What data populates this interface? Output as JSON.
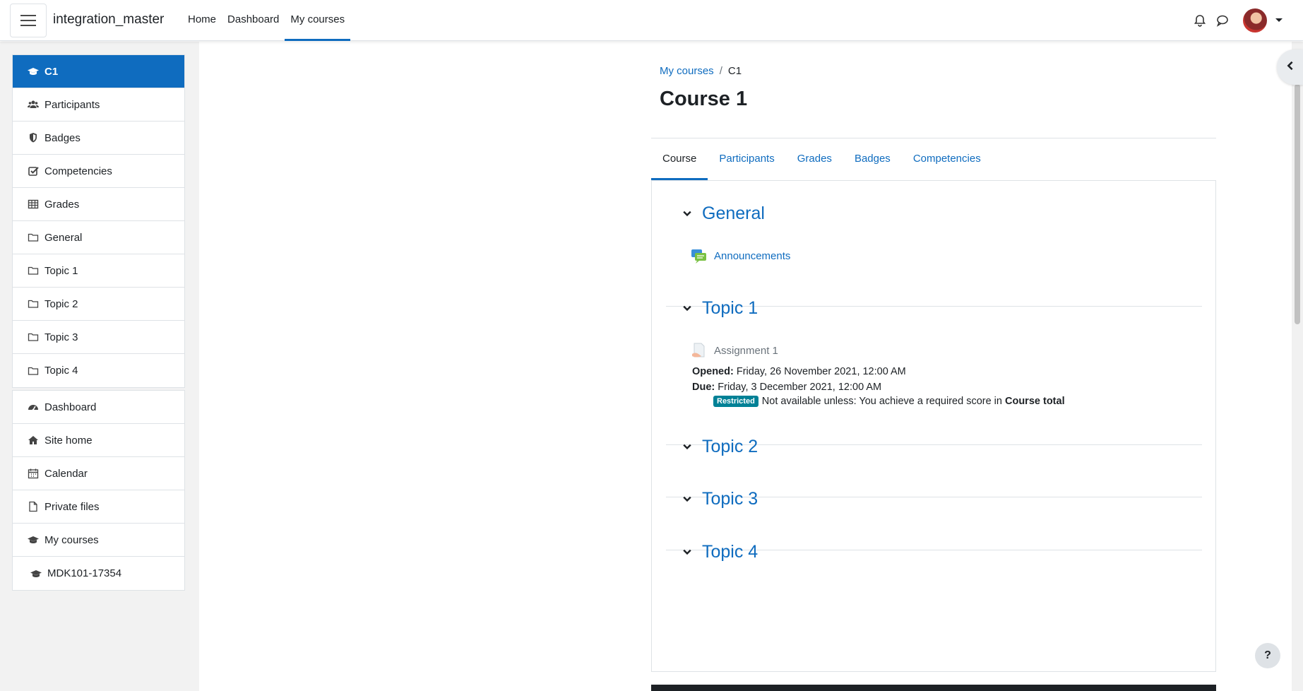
{
  "site": {
    "name": "integration_master"
  },
  "topnav": [
    {
      "label": "Home"
    },
    {
      "label": "Dashboard"
    },
    {
      "label": "My courses",
      "active": true
    }
  ],
  "drawer": {
    "course_items": [
      {
        "label": "C1",
        "icon": "graduation-cap-icon",
        "active": true
      },
      {
        "label": "Participants",
        "icon": "users-icon"
      },
      {
        "label": "Badges",
        "icon": "shield-icon"
      },
      {
        "label": "Competencies",
        "icon": "check-square-icon"
      },
      {
        "label": "Grades",
        "icon": "table-icon"
      },
      {
        "label": "General",
        "icon": "folder-icon"
      },
      {
        "label": "Topic 1",
        "icon": "folder-icon"
      },
      {
        "label": "Topic 2",
        "icon": "folder-icon"
      },
      {
        "label": "Topic 3",
        "icon": "folder-icon"
      },
      {
        "label": "Topic 4",
        "icon": "folder-icon"
      }
    ],
    "site_items": [
      {
        "label": "Dashboard",
        "icon": "tachometer-icon"
      },
      {
        "label": "Site home",
        "icon": "home-icon"
      },
      {
        "label": "Calendar",
        "icon": "calendar-icon"
      },
      {
        "label": "Private files",
        "icon": "file-icon"
      },
      {
        "label": "My courses",
        "icon": "graduation-cap-icon"
      },
      {
        "label": "MDK101-17354",
        "icon": "graduation-cap-icon"
      }
    ]
  },
  "breadcrumb": {
    "parent": "My courses",
    "separator": "/",
    "current": "C1"
  },
  "page": {
    "title": "Course 1"
  },
  "tabs": [
    {
      "label": "Course",
      "active": true
    },
    {
      "label": "Participants"
    },
    {
      "label": "Grades"
    },
    {
      "label": "Badges"
    },
    {
      "label": "Competencies"
    }
  ],
  "sections": {
    "general": {
      "title": "General",
      "activity": {
        "label": "Announcements",
        "icon": "forum-icon"
      }
    },
    "topic1": {
      "title": "Topic 1",
      "activity": {
        "label": "Assignment 1",
        "icon": "assignment-icon"
      },
      "opened_label": "Opened:",
      "opened_value": "Friday, 26 November 2021, 12:00 AM",
      "due_label": "Due:",
      "due_value": "Friday, 3 December 2021, 12:00 AM",
      "restriction_badge": "Restricted",
      "restriction_text": "Not available unless: You achieve a required score in",
      "restriction_bold": "Course total"
    },
    "topic2": {
      "title": "Topic 2"
    },
    "topic3": {
      "title": "Topic 3"
    },
    "topic4": {
      "title": "Topic 4"
    }
  },
  "help": {
    "label": "?"
  },
  "colors": {
    "brand": "#0f6cbf",
    "badge": "#008196"
  }
}
